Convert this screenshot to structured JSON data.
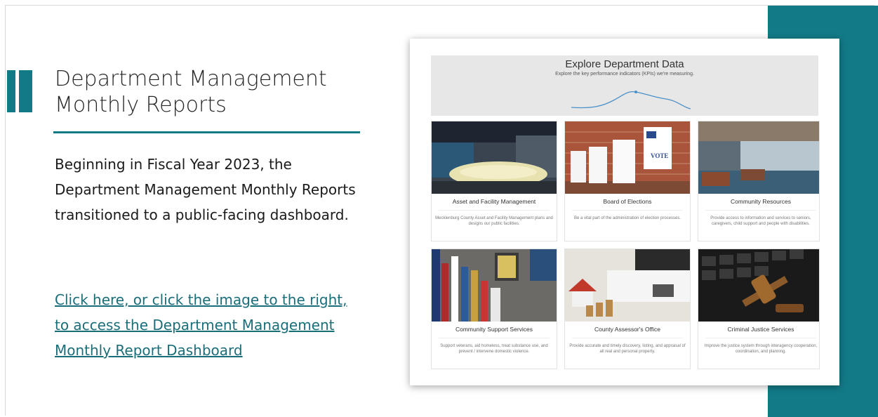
{
  "colors": {
    "accent": "#127a87",
    "link": "#1a6e7a",
    "title_text": "#262626"
  },
  "slide": {
    "title": "Department Management Monthly Reports",
    "body": "Beginning in Fiscal Year 2023, the Department Management Monthly Reports transitioned to a public-facing dashboard.",
    "link_text": "Click here, or click the image to the right, to access the Department Management Monthly Report Dashboard"
  },
  "dashboard": {
    "banner_title": "Explore Department Data",
    "banner_subtitle": "Explore the key performance indicators (KPIs) we're measuring.",
    "tiles": [
      {
        "title": "Asset and Facility Management",
        "description": "Mecklenburg County Asset and Facility Management plans and designs our public facilities.",
        "icon": "building-interior-image"
      },
      {
        "title": "Board of Elections",
        "description": "Be a vital part of the administration of election processes.",
        "icon": "voting-booths-image"
      },
      {
        "title": "Community Resources",
        "description": "Provide access to information and services to seniors, caregivers, child support and people with disabilities.",
        "icon": "lounge-interior-image"
      },
      {
        "title": "Community Support Services",
        "description": "Support veterans, aid homeless, treat substance use, and prevent / intervene domestic violence.",
        "icon": "flags-quilts-image"
      },
      {
        "title": "County Assessor's Office",
        "description": "Provide accurate and timely discovery, listing, and appraisal of all real and personal property.",
        "icon": "house-coins-image"
      },
      {
        "title": "Criminal Justice Services",
        "description": "Improve the justice system through interagency cooperation, coordination, and planning.",
        "icon": "gavel-keyboard-image"
      }
    ]
  }
}
